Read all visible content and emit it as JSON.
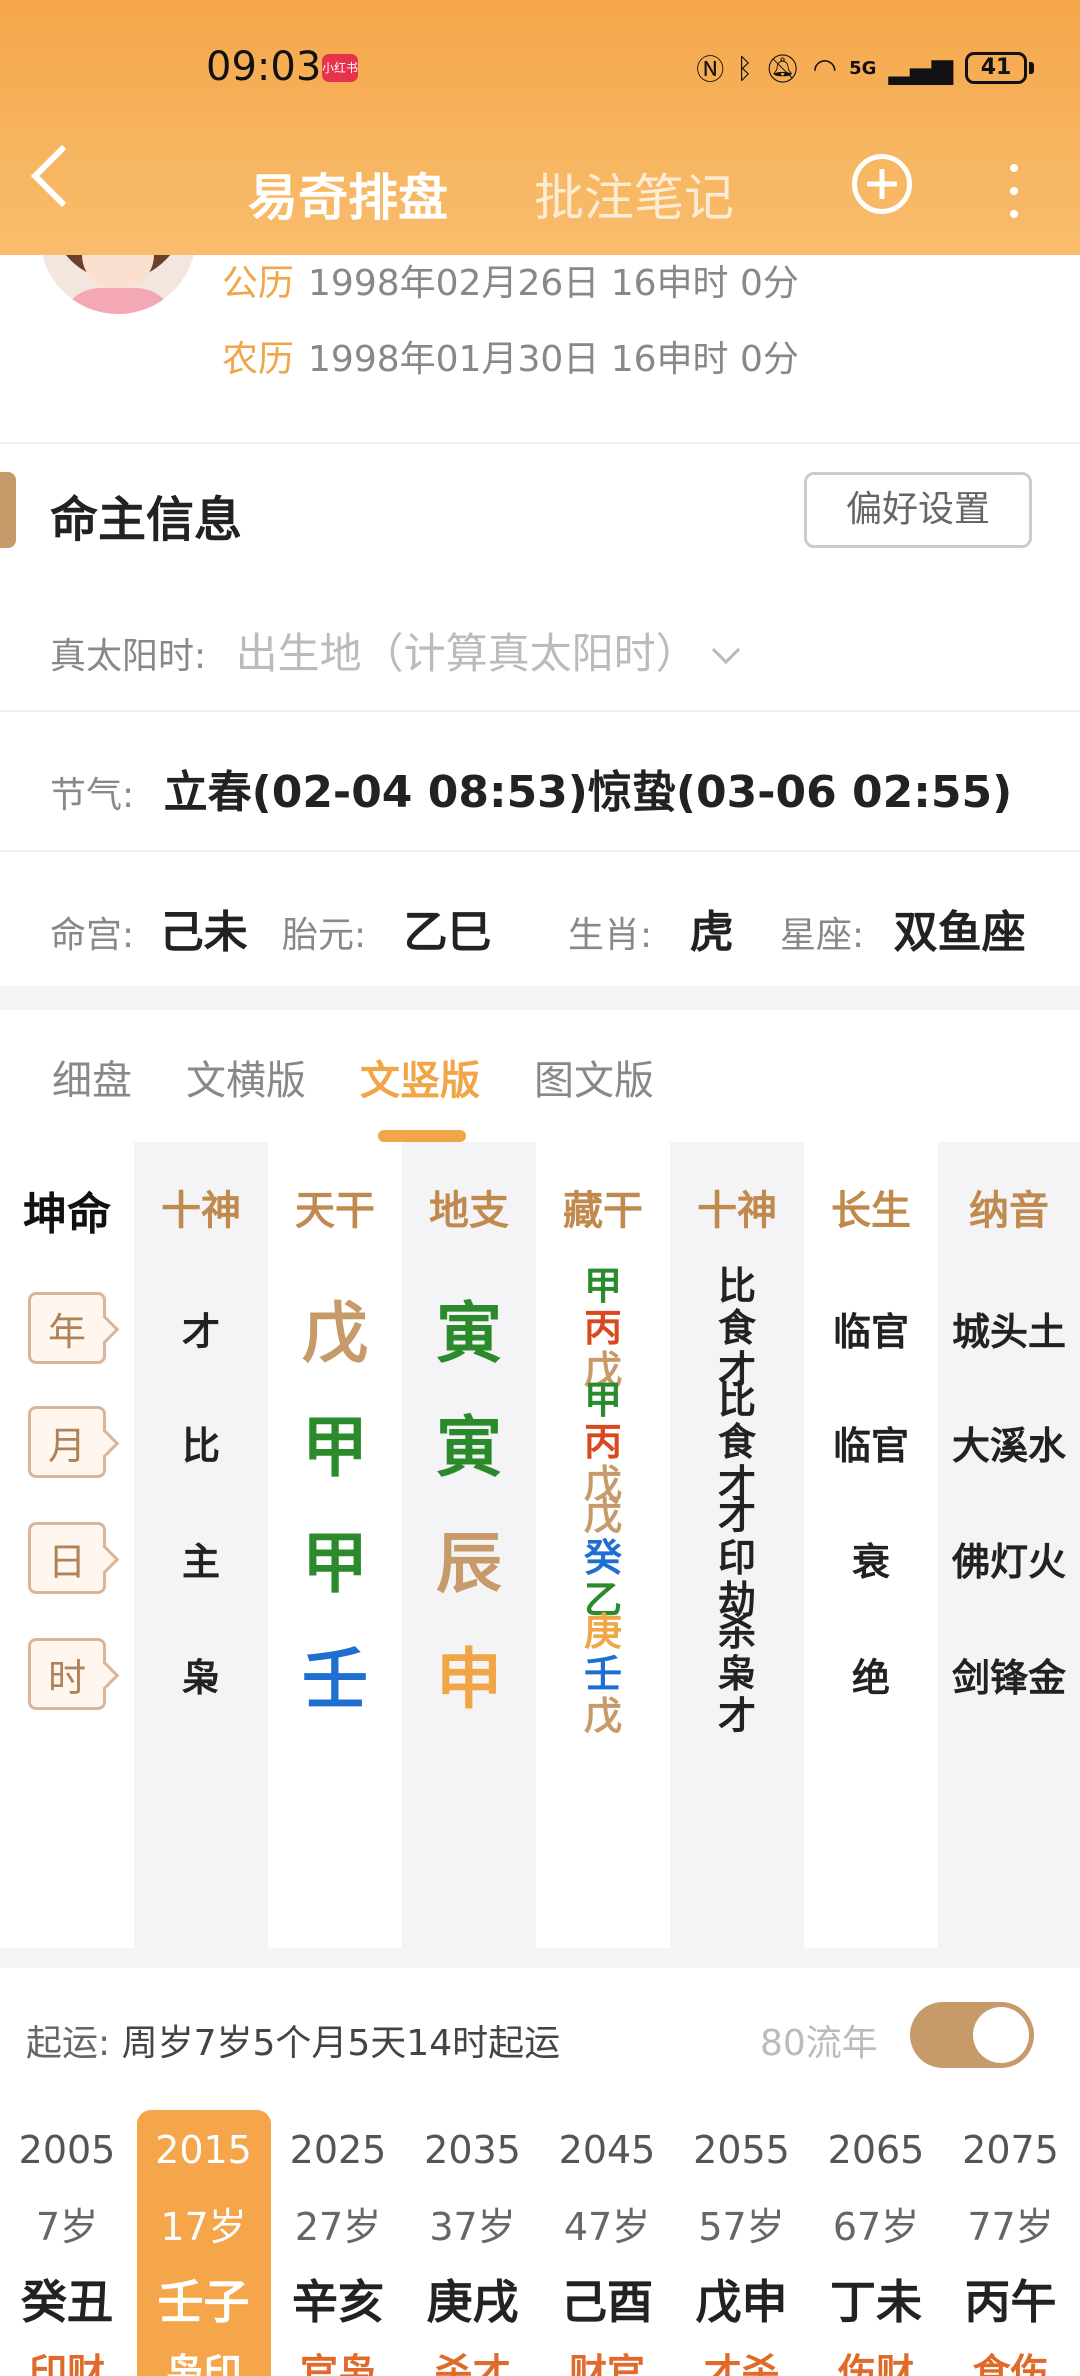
{
  "status": {
    "time": "09:03",
    "rec": "小红书",
    "battery": "41",
    "signal": "5G"
  },
  "nav": {
    "tab_active": "易奇排盘",
    "tab_other": "批注笔记"
  },
  "profile": {
    "solar_label": "公历",
    "solar_value": "1998年02月26日 16申时 0分",
    "lunar_label": "农历",
    "lunar_value": "1998年01月30日 16申时 0分"
  },
  "info": {
    "title": "命主信息",
    "pref_button": "偏好设置",
    "true_sun_label": "真太阳时:",
    "true_sun_value": "出生地（计算真太阳时）",
    "jieqi_label": "节气:",
    "jieqi_value": "立春(02-04 08:53)惊蛰(03-06 02:55)",
    "minggong_label": "命宫:",
    "minggong_value": "己未",
    "taiyuan_label": "胎元:",
    "taiyuan_value": "乙巳",
    "shengxiao_label": "生肖:",
    "shengxiao_value": "虎",
    "xingzuo_label": "星座:",
    "xingzuo_value": "双鱼座"
  },
  "view_tabs": [
    "细盘",
    "文横版",
    "文竖版",
    "图文版"
  ],
  "active_view_tab": 2,
  "grid": {
    "corner": "坤命",
    "headers": [
      "十神",
      "天干",
      "地支",
      "藏干",
      "十神",
      "长生",
      "纳音"
    ],
    "rows": [
      {
        "pillar": "年",
        "shishen": "才",
        "gan": "戊",
        "zhi": "寅",
        "canggan": [
          "甲",
          "丙",
          "戊"
        ],
        "zhi_shishen": [
          "比",
          "食",
          "才"
        ],
        "changsheng": "临官",
        "nayin": "城头土"
      },
      {
        "pillar": "月",
        "shishen": "比",
        "gan": "甲",
        "zhi": "寅",
        "canggan": [
          "甲",
          "丙",
          "戊"
        ],
        "zhi_shishen": [
          "比",
          "食",
          "才"
        ],
        "changsheng": "临官",
        "nayin": "大溪水"
      },
      {
        "pillar": "日",
        "shishen": "主",
        "gan": "甲",
        "zhi": "辰",
        "canggan": [
          "戊",
          "癸",
          "乙"
        ],
        "zhi_shishen": [
          "才",
          "印",
          "劫"
        ],
        "changsheng": "衰",
        "nayin": "佛灯火"
      },
      {
        "pillar": "时",
        "shishen": "枭",
        "gan": "壬",
        "zhi": "申",
        "canggan": [
          "庚",
          "壬",
          "戊"
        ],
        "zhi_shishen": [
          "杀",
          "枭",
          "才"
        ],
        "changsheng": "绝",
        "nayin": "剑锋金"
      }
    ],
    "colors": {
      "earth": "#c79a6a",
      "wood": "#2b8a2b",
      "fire": "#d9481f",
      "water": "#1f6fd1",
      "metal": "#f0a646"
    }
  },
  "qiyun": {
    "label": "起运:",
    "value": "周岁7岁5个月5天14时起运",
    "liunian_label": "80流年",
    "toggle_on": true
  },
  "dayun": [
    {
      "year": "2005",
      "age": "7岁",
      "ganzhi": "癸丑",
      "shishen": "印财"
    },
    {
      "year": "2015",
      "age": "17岁",
      "ganzhi": "壬子",
      "shishen": "枭印"
    },
    {
      "year": "2025",
      "age": "27岁",
      "ganzhi": "辛亥",
      "shishen": "官枭"
    },
    {
      "year": "2035",
      "age": "37岁",
      "ganzhi": "庚戌",
      "shishen": "杀才"
    },
    {
      "year": "2045",
      "age": "47岁",
      "ganzhi": "己酉",
      "shishen": "财官"
    },
    {
      "year": "2055",
      "age": "57岁",
      "ganzhi": "戊申",
      "shishen": "才杀"
    },
    {
      "year": "2065",
      "age": "67岁",
      "ganzhi": "丁未",
      "shishen": "伤财"
    },
    {
      "year": "2075",
      "age": "77岁",
      "ganzhi": "丙午",
      "shishen": "食伤"
    }
  ],
  "active_dayun": 1
}
